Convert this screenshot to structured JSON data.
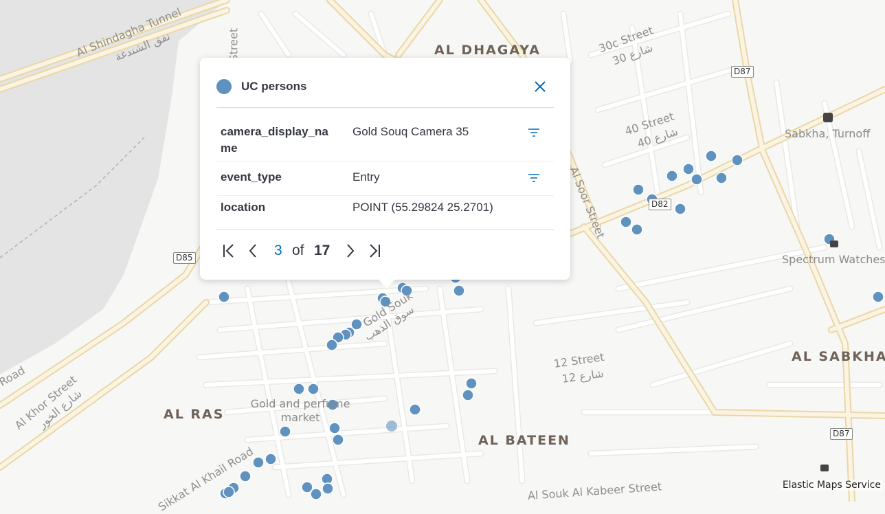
{
  "map": {
    "places": [
      "AL DHAGAYA",
      "AL RAS",
      "AL BATEEN",
      "AL SABKHA"
    ],
    "pois": [
      "Gold and perfume market",
      "Spectrum Watches",
      "Sabkha, Turnoff"
    ],
    "streets": [
      "Al Shindagha Tunnel",
      "نفق الشندغة",
      "Al Khor Street",
      "شارع الخور",
      "30c Street",
      "شارع 30",
      "40 Street",
      "شارع 40",
      "Al Soor Street",
      "Gold Souk",
      "سوق الذهب",
      "12 Street",
      "شارع 12",
      "Al Souk Al Kabeer Street",
      "Sikkat Al Khail Road",
      "Street",
      "Road"
    ],
    "shields": [
      "D85",
      "D87",
      "D82",
      "D87"
    ],
    "attribution": "Elastic Maps Service",
    "point_color": "#6092c0"
  },
  "popup": {
    "layer_name": "UC persons",
    "layer_color": "#6092c0",
    "close_icon": "close-icon",
    "filter_icon": "filter-icon",
    "rows": [
      {
        "key": "camera_display_name",
        "value": "Gold Souq Camera 35"
      },
      {
        "key": "event_type",
        "value": "Entry"
      },
      {
        "key": "location",
        "value": "POINT (55.29824 25.2701)"
      }
    ],
    "pager": {
      "current": "3",
      "of_label": "of",
      "total": "17"
    }
  }
}
